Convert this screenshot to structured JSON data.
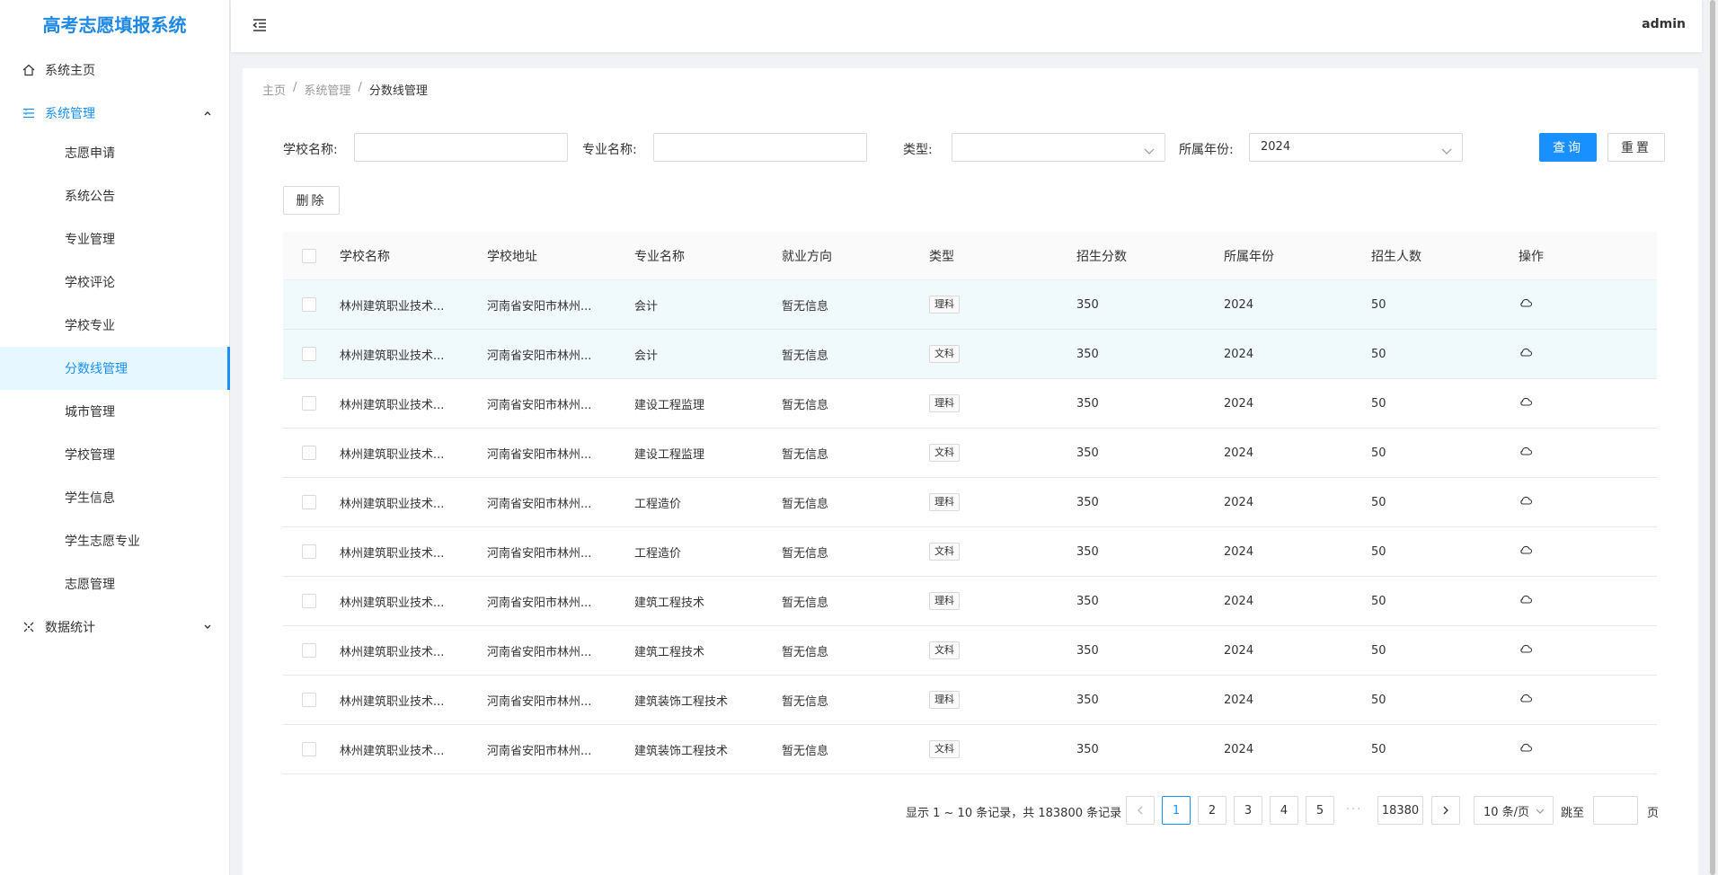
{
  "app": {
    "title": "高考志愿填报系统"
  },
  "header": {
    "user": "admin"
  },
  "sidebar": {
    "home": "系统主页",
    "system": "系统管理",
    "sub_items": [
      "志愿申请",
      "系统公告",
      "专业管理",
      "学校评论",
      "学校专业",
      "分数线管理",
      "城市管理",
      "学校管理",
      "学生信息",
      "学生志愿专业",
      "志愿管理"
    ],
    "stats": "数据统计"
  },
  "breadcrumb": {
    "home": "主页",
    "sep": "/",
    "section": "系统管理",
    "current": "分数线管理"
  },
  "search": {
    "school_label": "学校名称:",
    "major_label": "专业名称:",
    "type_label": "类型:",
    "year_label": "所属年份:",
    "year_value": "2024",
    "query_btn": "查询",
    "reset_btn": "重置",
    "delete_btn": "删除"
  },
  "table": {
    "columns": [
      "学校名称",
      "学校地址",
      "专业名称",
      "就业方向",
      "类型",
      "招生分数",
      "所属年份",
      "招生人数",
      "操作"
    ],
    "rows": [
      [
        "林州建筑职业技术...",
        "河南省安阳市林州...",
        "会计",
        "暂无信息",
        "理科",
        "350",
        "2024",
        "50"
      ],
      [
        "林州建筑职业技术...",
        "河南省安阳市林州...",
        "会计",
        "暂无信息",
        "文科",
        "350",
        "2024",
        "50"
      ],
      [
        "林州建筑职业技术...",
        "河南省安阳市林州...",
        "建设工程监理",
        "暂无信息",
        "理科",
        "350",
        "2024",
        "50"
      ],
      [
        "林州建筑职业技术...",
        "河南省安阳市林州...",
        "建设工程监理",
        "暂无信息",
        "文科",
        "350",
        "2024",
        "50"
      ],
      [
        "林州建筑职业技术...",
        "河南省安阳市林州...",
        "工程造价",
        "暂无信息",
        "理科",
        "350",
        "2024",
        "50"
      ],
      [
        "林州建筑职业技术...",
        "河南省安阳市林州...",
        "工程造价",
        "暂无信息",
        "文科",
        "350",
        "2024",
        "50"
      ],
      [
        "林州建筑职业技术...",
        "河南省安阳市林州...",
        "建筑工程技术",
        "暂无信息",
        "理科",
        "350",
        "2024",
        "50"
      ],
      [
        "林州建筑职业技术...",
        "河南省安阳市林州...",
        "建筑工程技术",
        "暂无信息",
        "文科",
        "350",
        "2024",
        "50"
      ],
      [
        "林州建筑职业技术...",
        "河南省安阳市林州...",
        "建筑装饰工程技术",
        "暂无信息",
        "理科",
        "350",
        "2024",
        "50"
      ],
      [
        "林州建筑职业技术...",
        "河南省安阳市林州...",
        "建筑装饰工程技术",
        "暂无信息",
        "文科",
        "350",
        "2024",
        "50"
      ]
    ]
  },
  "pagination": {
    "total_text": "显示 1 ~ 10 条记录，共 183800 条记录",
    "pages": [
      "1",
      "2",
      "3",
      "4",
      "5"
    ],
    "dots": "···",
    "last_page": "18380",
    "page_size": "10 条/页",
    "jump_label": "跳至",
    "page_unit": "页"
  },
  "colors": {
    "accent": "#1890ff",
    "brand": "#1e88e5"
  }
}
